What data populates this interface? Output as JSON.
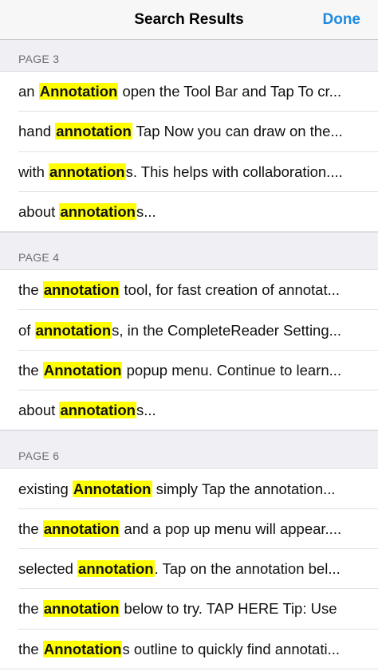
{
  "navbar": {
    "title": "Search Results",
    "done_label": "Done"
  },
  "colors": {
    "accent": "#1e8ae0",
    "highlight": "#ffff00",
    "section_background": "#efeff4",
    "section_text": "#6d6d72"
  },
  "sections": [
    {
      "header": "PAGE 3",
      "results": [
        {
          "before": "an ",
          "match": "Annotation",
          "after": " open the Tool Bar and Tap To cr..."
        },
        {
          "before": "hand ",
          "match": "annotation",
          "after": " Tap Now you can draw on the..."
        },
        {
          "before": "with ",
          "match": "annotation",
          "after": "s. This helps with collaboration...."
        },
        {
          "before": "about ",
          "match": "annotation",
          "after": "s..."
        }
      ]
    },
    {
      "header": "PAGE 4",
      "results": [
        {
          "before": "the ",
          "match": "annotation",
          "after": " tool, for fast creation of annotat..."
        },
        {
          "before": "of ",
          "match": "annotation",
          "after": "s, in the CompleteReader Setting..."
        },
        {
          "before": "the ",
          "match": "Annotation",
          "after": " popup menu. Continue to learn..."
        },
        {
          "before": "about ",
          "match": "annotation",
          "after": "s..."
        }
      ]
    },
    {
      "header": "PAGE 6",
      "results": [
        {
          "before": "existing ",
          "match": "Annotation",
          "after": " simply Tap the annotation..."
        },
        {
          "before": "the ",
          "match": "annotation",
          "after": " and a pop up menu will appear...."
        },
        {
          "before": "selected ",
          "match": "annotation",
          "after": ". Tap on the annotation bel..."
        },
        {
          "before": "the ",
          "match": "annotation",
          "after": " below to try. TAP HERE Tip: Use"
        },
        {
          "before": "the ",
          "match": "Annotation",
          "after": "s outline to quickly find annotati..."
        }
      ]
    }
  ]
}
